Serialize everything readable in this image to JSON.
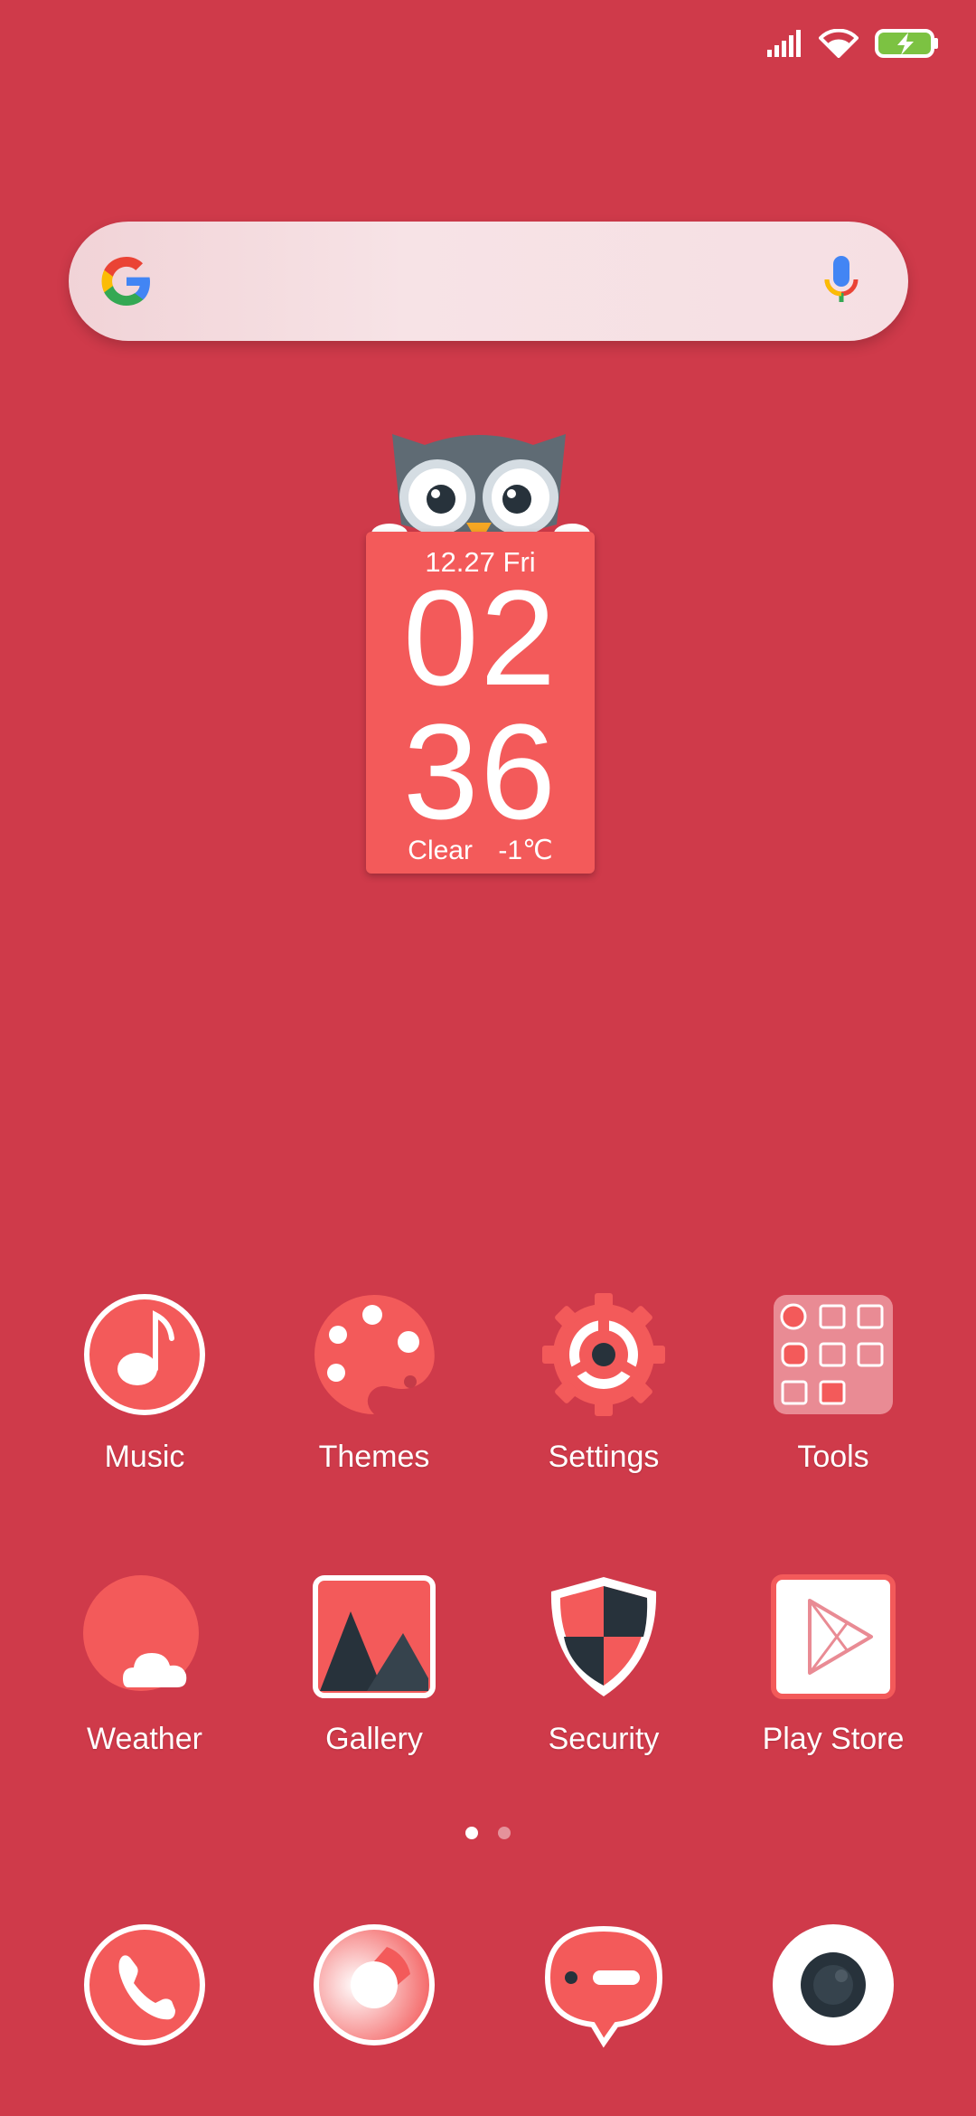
{
  "status_bar": {
    "icons": [
      "signal-icon",
      "wifi-icon",
      "battery-charging-icon"
    ]
  },
  "search": {
    "icons": [
      "google-logo",
      "microphone-icon"
    ]
  },
  "clock_widget": {
    "date": "12.27 Fri",
    "hour": "02",
    "minute": "36",
    "condition": "Clear",
    "temperature": "-1℃"
  },
  "apps_row1": [
    {
      "label": "Music",
      "icon": "music-note-icon"
    },
    {
      "label": "Themes",
      "icon": "palette-icon"
    },
    {
      "label": "Settings",
      "icon": "gear-icon"
    },
    {
      "label": "Tools",
      "icon": "folder-icon"
    }
  ],
  "apps_row2": [
    {
      "label": "Weather",
      "icon": "weather-icon"
    },
    {
      "label": "Gallery",
      "icon": "gallery-icon"
    },
    {
      "label": "Security",
      "icon": "shield-icon"
    },
    {
      "label": "Play Store",
      "icon": "play-store-icon"
    }
  ],
  "page_indicator": {
    "total": 2,
    "current": 1
  },
  "dock": [
    {
      "icon": "phone-icon"
    },
    {
      "icon": "browser-icon"
    },
    {
      "icon": "messages-icon"
    },
    {
      "icon": "camera-icon"
    }
  ],
  "colors": {
    "background": "#cf3a4a",
    "accent": "#f35a5a",
    "dark": "#27323b"
  }
}
